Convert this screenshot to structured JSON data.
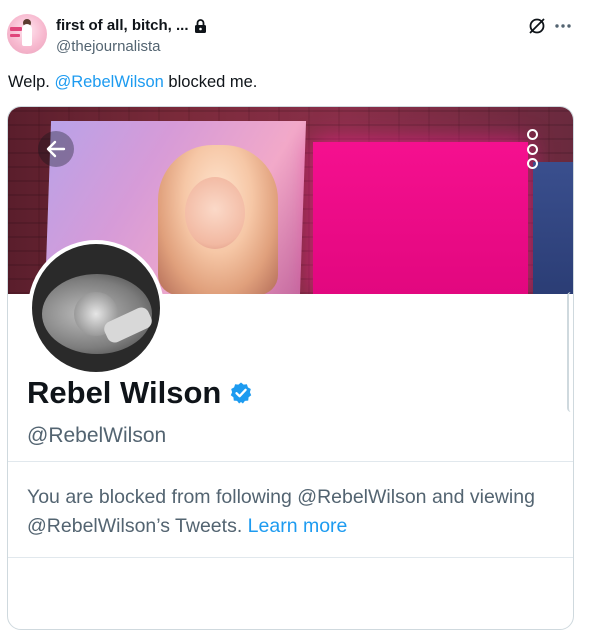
{
  "tweet": {
    "author_name": "first of all, bitch, ...",
    "author_handle": "@thejournalista",
    "text_before": "Welp. ",
    "mention": "@RebelWilson",
    "text_after": " blocked me."
  },
  "icons": {
    "lock": "lock-icon",
    "grok": "grok-icon",
    "more": "more-dots-icon",
    "back": "back-arrow-icon",
    "menu": "vertical-dots-icon",
    "verified": "verified-badge-icon"
  },
  "profile_card": {
    "display_name": "Rebel Wilson",
    "handle": "@RebelWilson",
    "blocked_message": "You are blocked from following @RebelWilson and viewing @RebelWilson’s Tweets. ",
    "learn_more": "Learn more"
  },
  "colors": {
    "accent": "#1d9bf0",
    "secondary_text": "#536471",
    "banner_pink": "#f5108f"
  }
}
